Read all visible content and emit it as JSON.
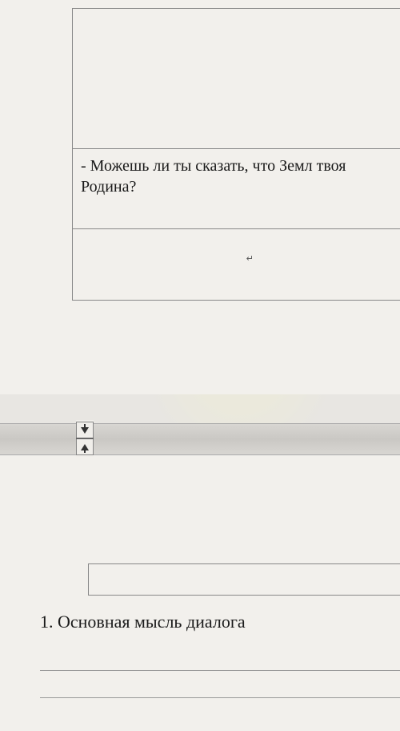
{
  "document": {
    "table": {
      "rows": [
        {
          "content": ""
        },
        {
          "content": "- Можешь ли ты сказать, что Земл твоя Родина?"
        },
        {
          "content": "",
          "cursor_mark": "↵"
        }
      ]
    },
    "page_break": {
      "icon": "collapse-pages-icon"
    },
    "bottom_section": {
      "heading": "1. Основная мысль диалога",
      "lines": [
        "",
        ""
      ]
    }
  }
}
